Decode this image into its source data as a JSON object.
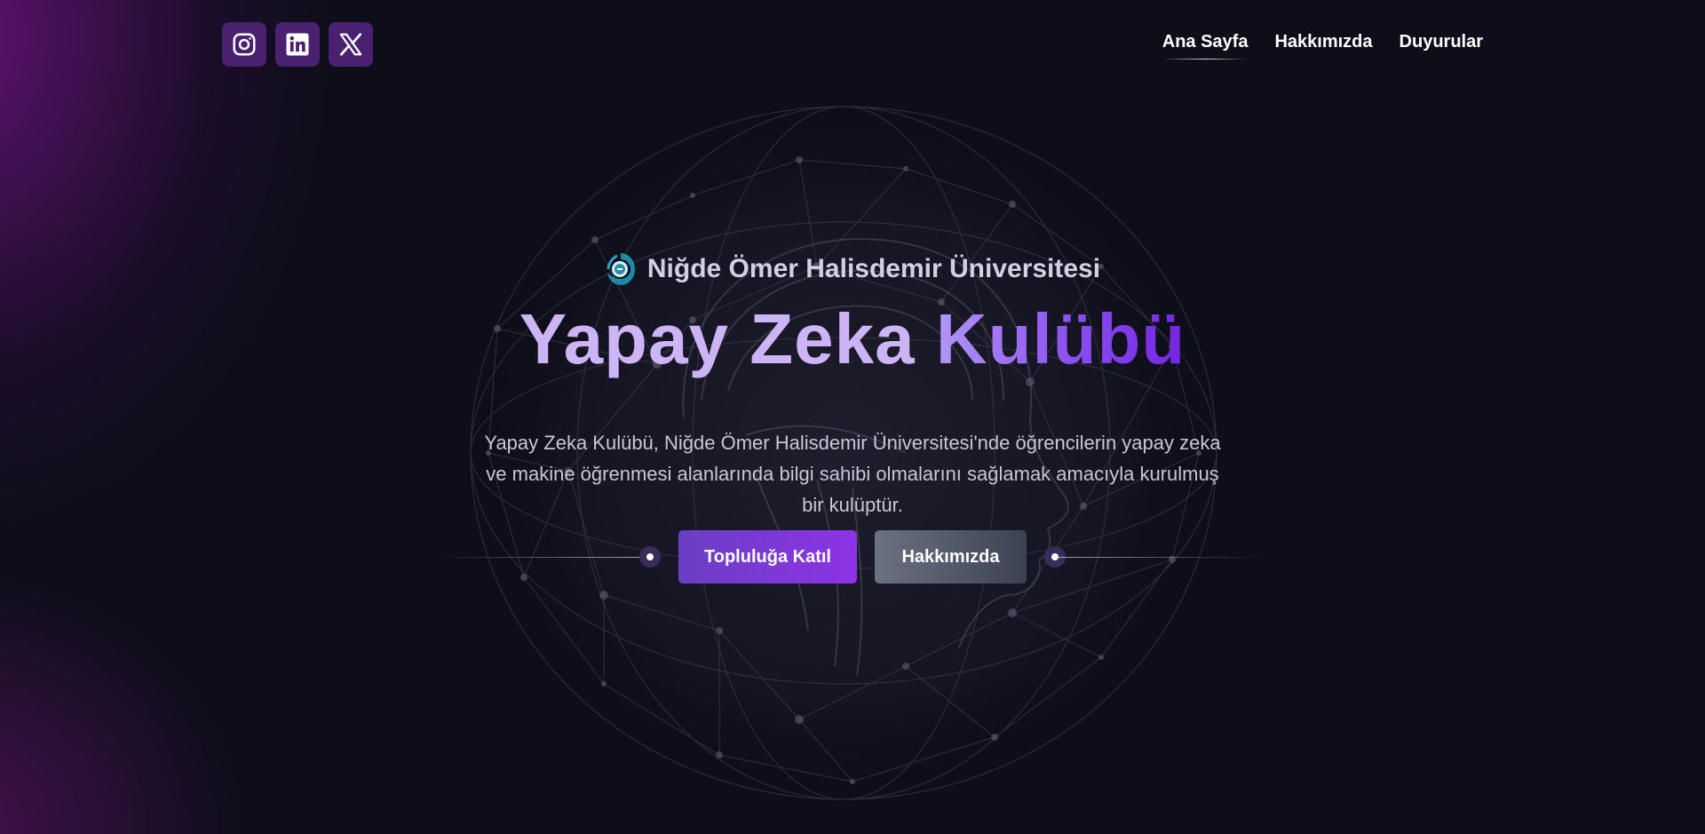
{
  "social": [
    {
      "icon": "instagram-icon"
    },
    {
      "icon": "linkedin-icon"
    },
    {
      "icon": "x-icon"
    }
  ],
  "nav": {
    "items": [
      {
        "label": "Ana Sayfa",
        "active": true
      },
      {
        "label": "Hakkımızda",
        "active": false
      },
      {
        "label": "Duyurular",
        "active": false
      }
    ]
  },
  "hero": {
    "university": "Niğde Ömer Halisdemir Üniversitesi",
    "title_part1": "Yapay Zeka",
    "title_part2": "Kulübü",
    "description": "Yapay Zeka Kulübü, Niğde Ömer Halisdemir Üniversitesi'nde öğrencilerin yapay zeka ve makine öğrenmesi alanlarında bilgi sahibi olmalarını sağlamak amacıyla kurulmuş bir kulüptür.",
    "primary_button": "Topluluğa Katıl",
    "secondary_button": "Hakkımızda"
  },
  "colors": {
    "background": "#0e0e1a",
    "accent": "#8d33e6",
    "social_button": "#4a2170",
    "title_light": "#cdb4f5"
  }
}
